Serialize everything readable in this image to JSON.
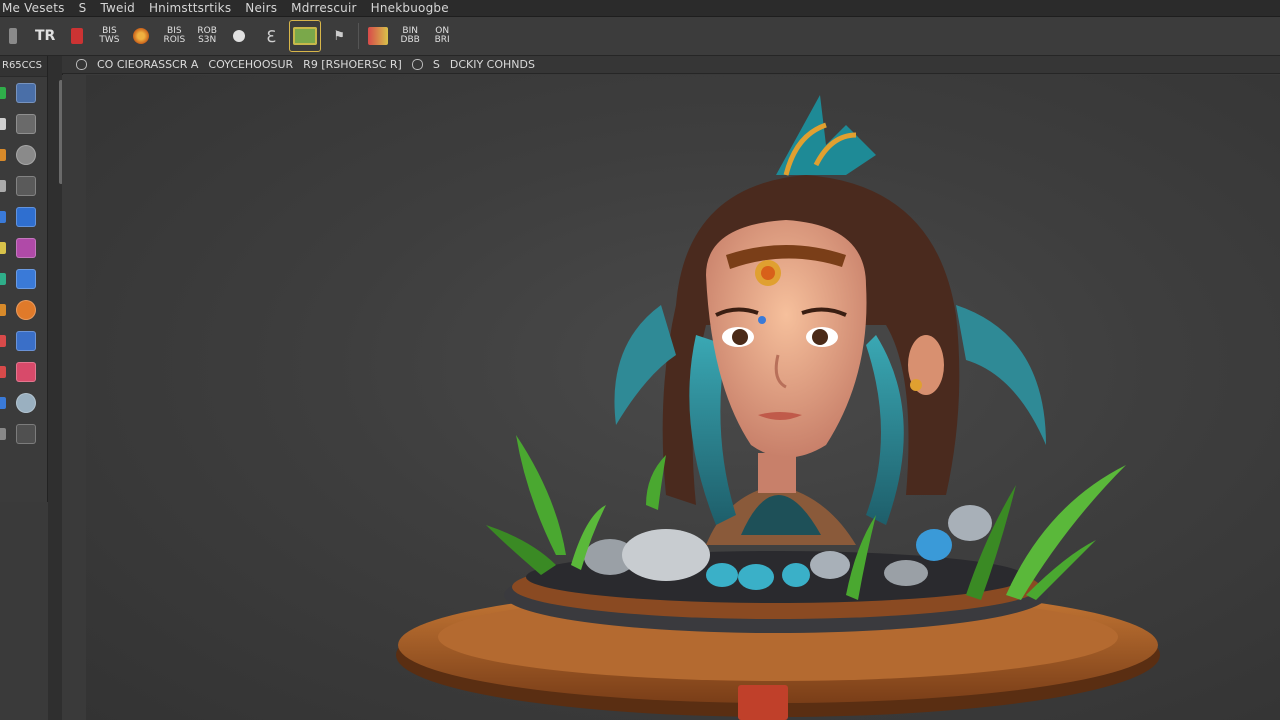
{
  "menubar": {
    "items": [
      "Me Vesets",
      "S",
      "Tweid",
      "Hnimsttsrtiks",
      "Neirs",
      "Mdrrescuir",
      "Hnekbuogbe"
    ]
  },
  "toolbar": {
    "buttons": [
      {
        "label": "",
        "icon": "rect-icon",
        "color": "#8a8a8a"
      },
      {
        "label": "TR",
        "icon": "text-icon",
        "color": "#c8c8c8"
      },
      {
        "label": "",
        "icon": "record-icon",
        "color": "#cc3333"
      },
      {
        "label": "BIS\nTWS",
        "icon": "",
        "color": ""
      },
      {
        "label": "",
        "icon": "brush-icon",
        "color": "#d88a2a"
      },
      {
        "label": "BIS\nROIS",
        "icon": "",
        "color": ""
      },
      {
        "label": "ROB\nS3N",
        "icon": "",
        "color": ""
      },
      {
        "label": "",
        "icon": "paint-icon",
        "color": "#e0e0e0"
      },
      {
        "label": "",
        "icon": "edit-icon",
        "color": "#d0d0d0"
      },
      {
        "label": "",
        "icon": "image-icon",
        "color": "#7aa84a",
        "active": true
      },
      {
        "label": "",
        "icon": "tag-icon",
        "color": "#cccccc"
      },
      {
        "label": "",
        "icon": "palette-icon",
        "color": "#d84a4a"
      },
      {
        "label": "BIN\nDBB",
        "icon": "",
        "color": ""
      },
      {
        "label": "ON\nBRI",
        "icon": "",
        "color": ""
      }
    ]
  },
  "leftpanel": {
    "title": "R65CCS",
    "tools": [
      {
        "icon": "layer-icon",
        "mini": "#2fae4a",
        "big": "#4a6fa8"
      },
      {
        "icon": "transform-icon",
        "mini": "#d0d0d0",
        "big": "#6a6a6a"
      },
      {
        "icon": "lasso-icon",
        "mini": "#d88a2a",
        "big": "#8a8a8a"
      },
      {
        "icon": "grid-icon",
        "mini": "#aaaaaa",
        "big": "#5a5a5a"
      },
      {
        "icon": "select-icon",
        "mini": "#3a7ad8",
        "big": "#2f6fd0"
      },
      {
        "icon": "pencil-icon",
        "mini": "#d8c24a",
        "big": "#b04aa8"
      },
      {
        "icon": "cube-icon",
        "mini": "#2fae8a",
        "big": "#3a7ad8"
      },
      {
        "icon": "paint-bucket-icon",
        "mini": "#d88a2a",
        "big": "#e07a2a"
      },
      {
        "icon": "eraser-icon",
        "mini": "#d84a4a",
        "big": "#3a6fc8"
      },
      {
        "icon": "picker-icon",
        "mini": "#d84a4a",
        "big": "#d84a6a"
      },
      {
        "icon": "globe-icon",
        "mini": "#3a7ad8",
        "big": "#9ab0c0"
      },
      {
        "icon": "settings-icon",
        "mini": "#888888",
        "big": "#505050"
      }
    ]
  },
  "tabbar": {
    "tabs": [
      "CO CIEORASSCR A",
      "COYCEHOOSUR",
      "R9 [RSHOERSC R]",
      "S",
      "DCKIY COHNDS"
    ]
  },
  "colors": {
    "background": "#3a3a3a",
    "viewport": "#3e3e3e",
    "hair": "#4a2a1e",
    "hair_teal": "#2f8a96",
    "skin": "#e8a884",
    "gold": "#e0a030",
    "wood": "#a8602a",
    "leaf": "#4aa830"
  }
}
